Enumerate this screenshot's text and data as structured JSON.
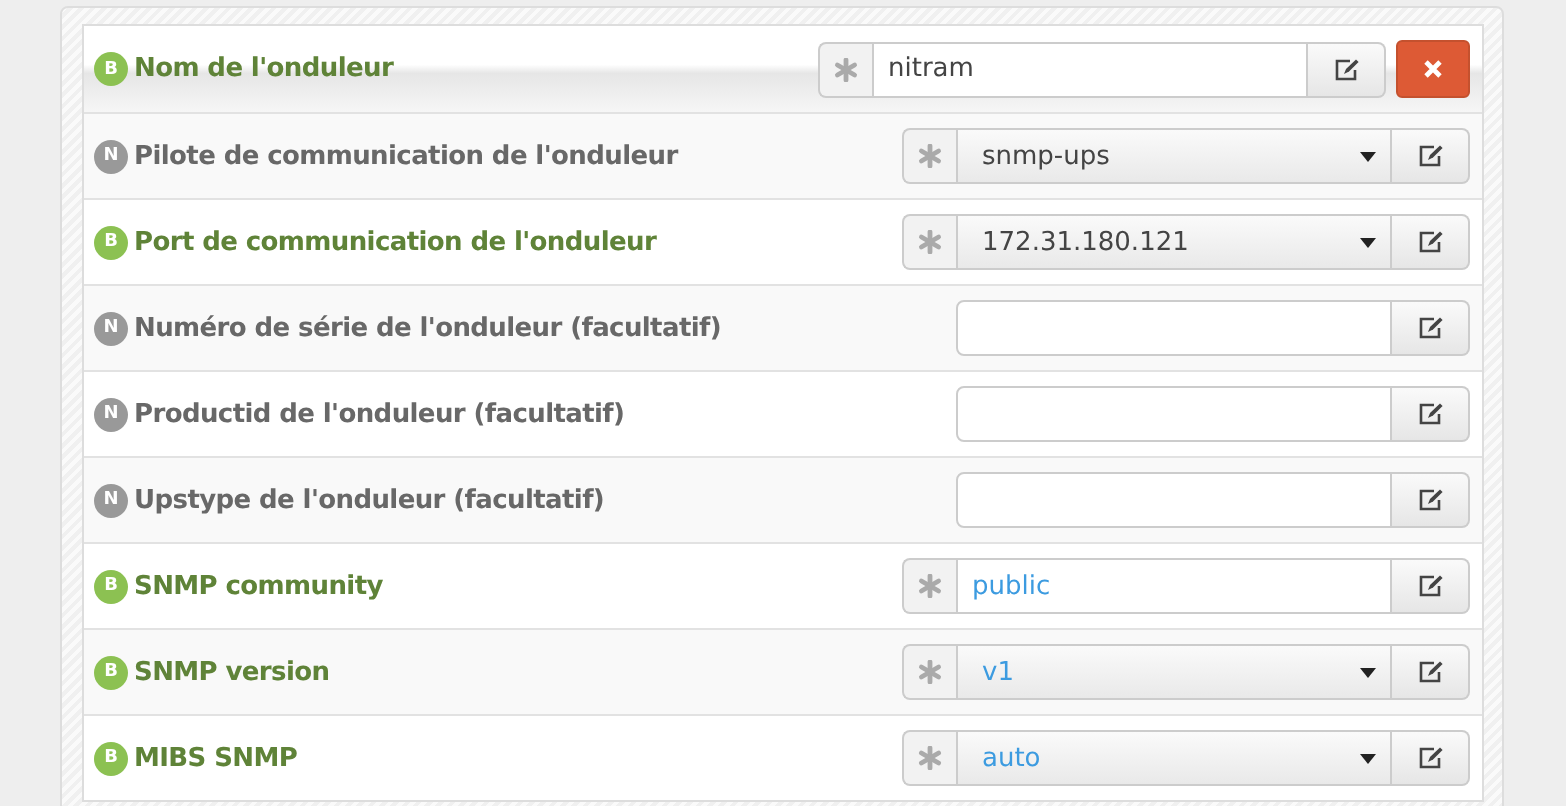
{
  "rows": [
    {
      "badge": "B",
      "color": "#8cc152",
      "label": "Nom de l'onduleur",
      "required": true,
      "kind": "input",
      "value": "nitram",
      "default": false,
      "removable": true
    },
    {
      "badge": "N",
      "color": "#999999",
      "label": "Pilote de communication de l'onduleur",
      "required": true,
      "kind": "select",
      "value": "snmp-ups",
      "default": false,
      "removable": false
    },
    {
      "badge": "B",
      "color": "#8cc152",
      "label": "Port de communication de l'onduleur",
      "required": true,
      "kind": "select",
      "value": "172.31.180.121",
      "default": false,
      "removable": false
    },
    {
      "badge": "N",
      "color": "#999999",
      "label": "Numéro de série de l'onduleur (facultatif)",
      "required": false,
      "kind": "input",
      "removable": false
    },
    {
      "badge": "N",
      "color": "#999999",
      "label": "Productid de l'onduleur (facultatif)",
      "required": false,
      "kind": "input",
      "removable": false
    },
    {
      "badge": "N",
      "color": "#999999",
      "label": "Upstype de l'onduleur (facultatif)",
      "required": false,
      "kind": "input",
      "removable": false
    },
    {
      "badge": "B",
      "color": "#8cc152",
      "label": "SNMP community",
      "required": true,
      "kind": "input",
      "value": "public",
      "default": true,
      "removable": false
    },
    {
      "badge": "B",
      "color": "#8cc152",
      "label": "SNMP version",
      "required": true,
      "kind": "select",
      "value": "v1",
      "default": true,
      "removable": false
    },
    {
      "badge": "B",
      "color": "#8cc152",
      "label": "MIBS SNMP",
      "required": true,
      "kind": "select",
      "value": "auto",
      "default": true,
      "removable": false
    }
  ]
}
